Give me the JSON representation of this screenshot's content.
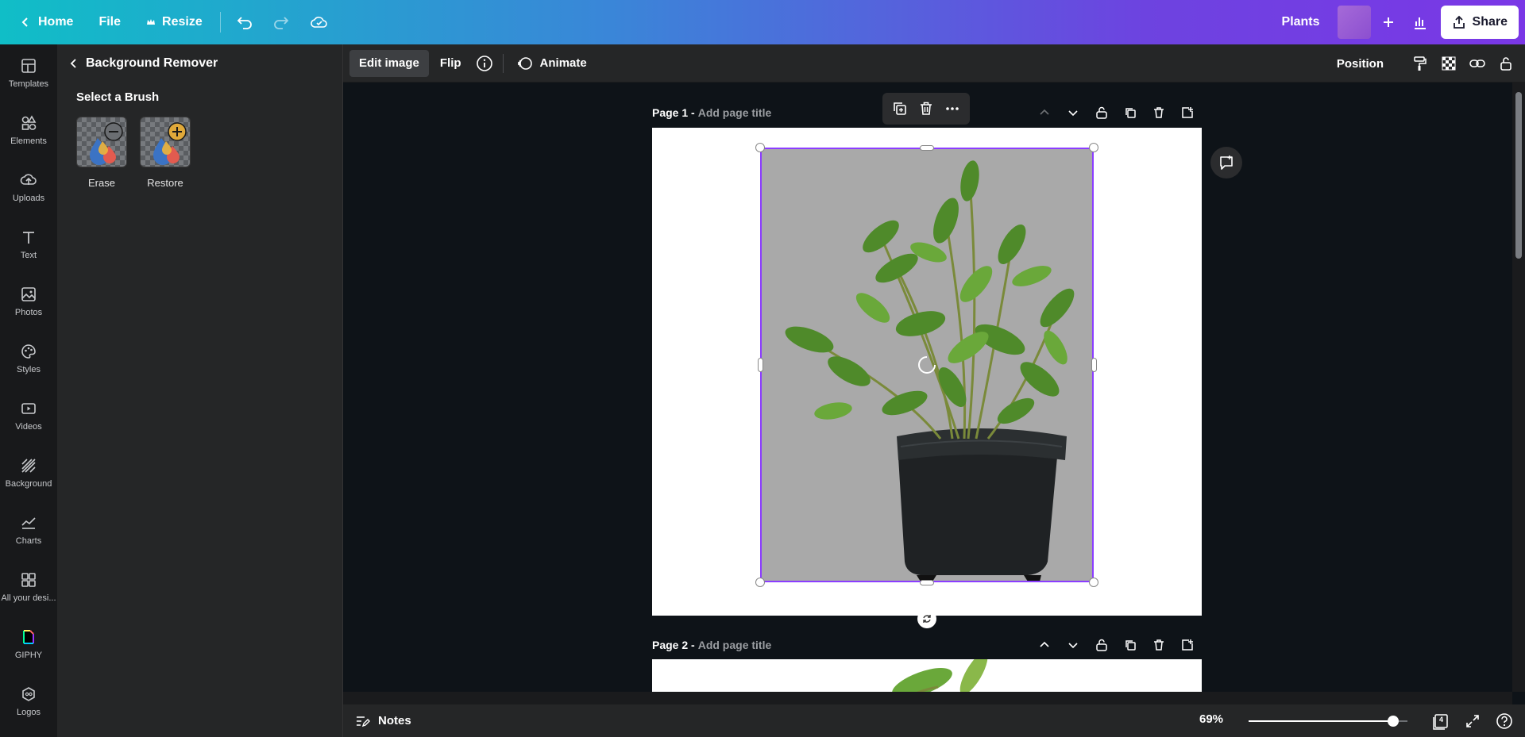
{
  "topbar": {
    "home_label": "Home",
    "file_label": "File",
    "resize_label": "Resize",
    "project_name": "Plants",
    "share_label": "Share"
  },
  "rail": {
    "items": [
      {
        "label": "Templates",
        "icon": "templates-icon"
      },
      {
        "label": "Elements",
        "icon": "elements-icon"
      },
      {
        "label": "Uploads",
        "icon": "uploads-icon"
      },
      {
        "label": "Text",
        "icon": "text-icon"
      },
      {
        "label": "Photos",
        "icon": "photos-icon"
      },
      {
        "label": "Styles",
        "icon": "styles-icon"
      },
      {
        "label": "Videos",
        "icon": "videos-icon"
      },
      {
        "label": "Background",
        "icon": "background-icon"
      },
      {
        "label": "Charts",
        "icon": "charts-icon"
      },
      {
        "label": "All your desi...",
        "icon": "all-designs-icon"
      },
      {
        "label": "GIPHY",
        "icon": "giphy-icon"
      },
      {
        "label": "Logos",
        "icon": "logos-icon"
      }
    ]
  },
  "panel": {
    "title": "Background Remover",
    "brush_heading": "Select a Brush",
    "brushes": [
      {
        "label": "Erase"
      },
      {
        "label": "Restore"
      }
    ]
  },
  "context_toolbar": {
    "edit_image_label": "Edit image",
    "flip_label": "Flip",
    "animate_label": "Animate",
    "position_label": "Position"
  },
  "pages": [
    {
      "number_label": "Page 1 -",
      "title_placeholder": "Add page title"
    },
    {
      "number_label": "Page 2 -",
      "title_placeholder": "Add page title"
    }
  ],
  "bottombar": {
    "notes_label": "Notes",
    "zoom_label": "69%",
    "zoom_level": 0.69,
    "page_count": "4"
  },
  "colors": {
    "accent": "#8b3dff",
    "topbar_start": "#10bec7",
    "topbar_end": "#7a37e6"
  }
}
